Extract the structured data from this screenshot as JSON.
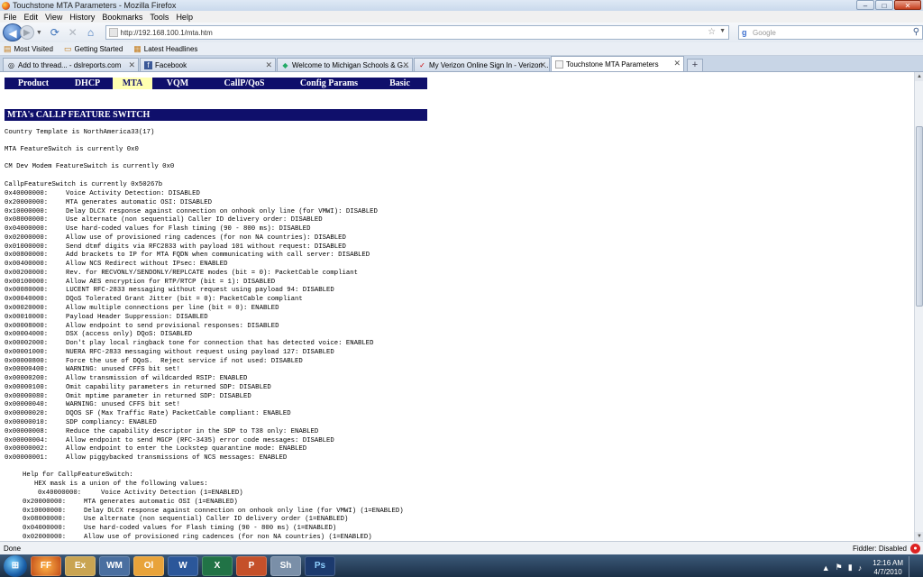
{
  "window": {
    "title": "Touchstone MTA Parameters - Mozilla Firefox",
    "minimize": "–",
    "maximize": "□",
    "close": "✕"
  },
  "menu": [
    "File",
    "Edit",
    "View",
    "History",
    "Bookmarks",
    "Tools",
    "Help"
  ],
  "nav": {
    "url": "http://192.168.100.1/mta.htm",
    "search_placeholder": "Google"
  },
  "bookmarks": [
    "Most Visited",
    "Getting Started",
    "Latest Headlines"
  ],
  "tabs": [
    {
      "label": "Add to thread... - dslreports.com",
      "active": false
    },
    {
      "label": "Facebook",
      "active": false
    },
    {
      "label": "Welcome to Michigan Schools & G...",
      "active": false
    },
    {
      "label": "My Verizon Online Sign In - Verizon ...",
      "active": false
    },
    {
      "label": "Touchstone MTA Parameters",
      "active": true
    }
  ],
  "page": {
    "nav_items": [
      "Product",
      "DHCP",
      "MTA",
      "VQM",
      "CallP/QoS",
      "Config Params",
      "Basic"
    ],
    "nav_selected": "MTA",
    "section_title": "MTA's CALLP FEATURE SWITCH",
    "country_template": "Country Template is NorthAmerica33(17)",
    "mta_featureswitch": "MTA FeatureSwitch is currently 0x0",
    "cm_featureswitch": "CM Dev Modem FeatureSwitch is currently 0x0",
    "callp_featureswitch": "CallpFeatureSwitch is currently 0x50267b",
    "flags": [
      {
        "hex": "0x40000000:",
        "desc": "Voice Activity Detection: DISABLED"
      },
      {
        "hex": "0x20000000:",
        "desc": "MTA generates automatic OSI: DISABLED"
      },
      {
        "hex": "0x10000000:",
        "desc": "Delay DLCX response against connection on onhook only line (for VMWI): DISABLED"
      },
      {
        "hex": "0x08000000:",
        "desc": "Use alternate (non sequential) Caller ID delivery order: DISABLED"
      },
      {
        "hex": "0x04000000:",
        "desc": "Use hard-coded values for Flash timing (90 - 800 ms): DISABLED"
      },
      {
        "hex": "0x02000000:",
        "desc": "Allow use of provisioned ring cadences (for non NA countries): DISABLED"
      },
      {
        "hex": "0x01000000:",
        "desc": "Send dtmf digits via RFC2833 with payload 101 without request: DISABLED"
      },
      {
        "hex": "0x00800000:",
        "desc": "Add brackets to IP for MTA FQDN when communicating with call server: DISABLED"
      },
      {
        "hex": "0x00400000:",
        "desc": "Allow NCS Redirect without IPsec: ENABLED"
      },
      {
        "hex": "0x00200000:",
        "desc": "Rev. for RECVONLY/SENDONLY/REPLCATE modes (bit = 0): PacketCable compliant"
      },
      {
        "hex": "0x00100000:",
        "desc": "Allow AES encryption for RTP/RTCP (bit = 1): DISABLED"
      },
      {
        "hex": "0x00080000:",
        "desc": "LUCENT RFC-2833 messaging without request using payload 94: DISABLED"
      },
      {
        "hex": "0x00040000:",
        "desc": "DQoS Tolerated Grant Jitter (bit = 0): PacketCable compliant"
      },
      {
        "hex": "0x00020000:",
        "desc": "Allow multiple connections per line (bit = 0): ENABLED"
      },
      {
        "hex": "0x00010000:",
        "desc": "Payload Header Suppression: DISABLED"
      },
      {
        "hex": "0x00008000:",
        "desc": "Allow endpoint to send provisional responses: DISABLED"
      },
      {
        "hex": "0x00004000:",
        "desc": "DSX (access only) DQoS: DISABLED"
      },
      {
        "hex": "0x00002000:",
        "desc": "Don't play local ringback tone for connection that has detected voice: ENABLED"
      },
      {
        "hex": "0x00001000:",
        "desc": "NUERA RFC-2833 messaging without request using payload 127: DISABLED"
      },
      {
        "hex": "0x00000800:",
        "desc": "Force the use of DQoS.  Reject service if not used: DISABLED"
      },
      {
        "hex": "0x00000400:",
        "desc": "WARNING: unused CFFS bit set!"
      },
      {
        "hex": "0x00000200:",
        "desc": "Allow transmission of wildcarded RSIP: ENABLED"
      },
      {
        "hex": "0x00000100:",
        "desc": "Omit capability parameters in returned SDP: DISABLED"
      },
      {
        "hex": "0x00000080:",
        "desc": "Omit mptime parameter in returned SDP: DISABLED"
      },
      {
        "hex": "0x00000040:",
        "desc": "WARNING: unused CFFS bit set!"
      },
      {
        "hex": "0x00000020:",
        "desc": "DQOS SF (Max Traffic Rate) PacketCable compliant: ENABLED"
      },
      {
        "hex": "0x00000010:",
        "desc": "SDP compliancy: ENABLED"
      },
      {
        "hex": "0x00000008:",
        "desc": "Reduce the capability descriptor in the SDP to T38 only: ENABLED"
      },
      {
        "hex": "0x00000004:",
        "desc": "Allow endpoint to send MGCP (RFC-3435) error code messages: DISABLED"
      },
      {
        "hex": "0x00000002:",
        "desc": "Allow endpoint to enter the Lockstep quarantine mode: ENABLED"
      },
      {
        "hex": "0x00000001:",
        "desc": "Allow piggybacked transmissions of NCS messages: ENABLED"
      }
    ],
    "help": {
      "title": "Help for CallpFeatureSwitch:",
      "intro": "HEX mask is a union of the following values:",
      "items": [
        {
          "hex": "0x40000000:",
          "desc": "Voice Activity Detection (1=ENABLED)"
        },
        {
          "hex": "0x20000000:",
          "desc": "MTA generates automatic OSI (1=ENABLED)"
        },
        {
          "hex": "0x10000000:",
          "desc": "Delay DLCX response against connection on onhook only line (for VMWI) (1=ENABLED)"
        },
        {
          "hex": "0x08000000:",
          "desc": "Use alternate (non sequential) Caller ID delivery order (1=ENABLED)"
        },
        {
          "hex": "0x04000000:",
          "desc": "Use hard-coded values for Flash timing (90 - 800 ms) (1=ENABLED)"
        },
        {
          "hex": "0x02000000:",
          "desc": "Allow use of provisioned ring cadences (for non NA countries) (1=ENABLED)"
        }
      ]
    }
  },
  "status": {
    "text": "Done",
    "fiddler": "Fiddler: Disabled"
  },
  "taskbar": {
    "apps": [
      "FF",
      "Ex",
      "WM",
      "Ol",
      "W",
      "X",
      "P",
      "Sh",
      "Ps"
    ],
    "time": "12:16 AM",
    "date": "4/7/2010"
  }
}
